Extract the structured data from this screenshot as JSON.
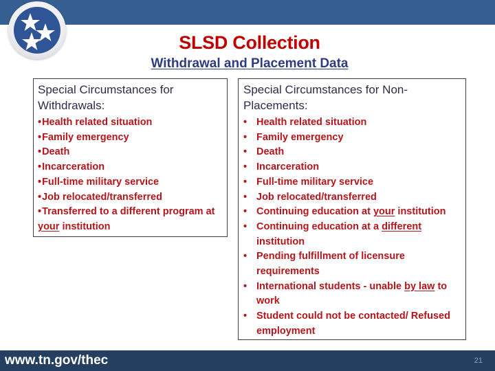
{
  "header": {
    "logo_icon": "tennessee-tri-star-icon",
    "title": "SLSD Collection",
    "subtitle": "Withdrawal and Placement Data"
  },
  "colors": {
    "top_band": "#365f91",
    "title_red": "#c00000",
    "subtitle_navy": "#2e3c7e",
    "bullet_text_red": "#b3161b",
    "footer_band": "#243f60"
  },
  "withdrawals": {
    "heading": "Special Circumstances for Withdrawals:",
    "bullet": "•",
    "items": [
      {
        "text": "Health related situation"
      },
      {
        "text": "Family emergency"
      },
      {
        "text": "Death"
      },
      {
        "text": "Incarceration"
      },
      {
        "text": "Full-time military service"
      },
      {
        "text": "Job relocated/transferred"
      },
      {
        "before": "Transferred to a different program at ",
        "underline": "your",
        "after": " institution"
      }
    ]
  },
  "non_placements": {
    "heading": "Special Circumstances for Non-Placements:",
    "bullet": "•",
    "items": [
      {
        "text": "Health related situation"
      },
      {
        "text": "Family emergency"
      },
      {
        "text": "Death"
      },
      {
        "text": "Incarceration"
      },
      {
        "text": "Full-time military service"
      },
      {
        "text": "Job relocated/transferred"
      },
      {
        "before": "Continuing education at ",
        "underline": "your",
        "after": " institution"
      },
      {
        "before": "Continuing education at a ",
        "underline": "different",
        "after": " institution"
      },
      {
        "text": "Pending fulfillment of licensure requirements"
      },
      {
        "before": "International students - unable ",
        "underline": "by law",
        "after": " to work"
      },
      {
        "text": "Student could not be contacted/ Refused employment"
      }
    ]
  },
  "footer": {
    "url": "www.tn.gov/thec",
    "page_number": "21"
  }
}
